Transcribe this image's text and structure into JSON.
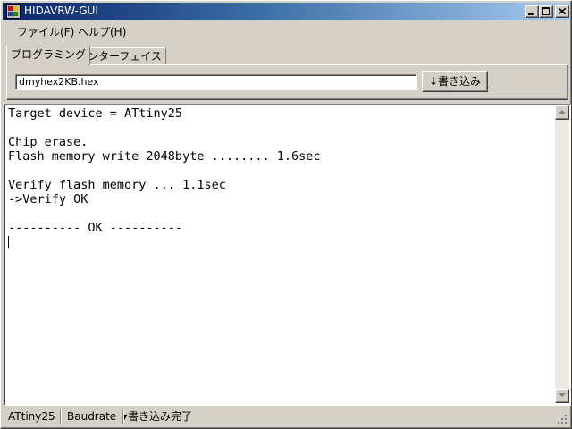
{
  "window": {
    "title": "HIDAVRW-GUI"
  },
  "menu": {
    "items": [
      "ファイル(F)",
      "ヘルプ(H)"
    ]
  },
  "tabs": [
    {
      "label": "プログラミング",
      "active": true
    },
    {
      "label": "インターフェイス",
      "active": false
    }
  ],
  "programming": {
    "file_value": "dmyhex2KB.hex",
    "write_button": "↓書き込み"
  },
  "log": {
    "lines": [
      "Target device = ATtiny25",
      "",
      "Chip erase.",
      "Flash memory write 2048byte ........ 1.6sec",
      "",
      "Verify flash memory ... 1.1sec",
      "->Verify OK",
      "",
      "---------- OK ----------"
    ]
  },
  "status": {
    "device": "ATtiny25",
    "baudrate": "Baudrate",
    "message": "書き込み完了"
  },
  "colors": {
    "titlebar_start": "#0a246a",
    "titlebar_end": "#a6caf0",
    "face": "#d4d0c8"
  }
}
